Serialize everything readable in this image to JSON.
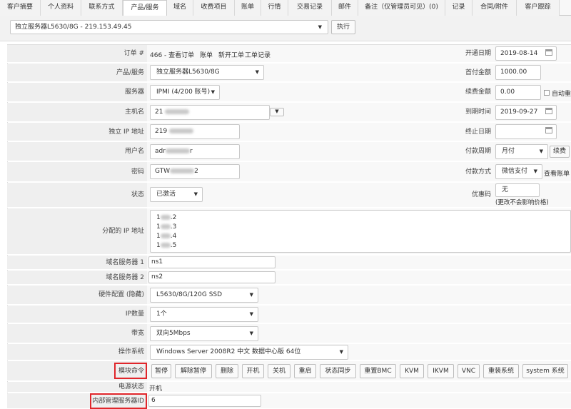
{
  "tabs": [
    "客户摘要",
    "个人资料",
    "联系方式",
    "产品/服务",
    "域名",
    "收费项目",
    "账单",
    "行情",
    "交易记录",
    "邮件",
    "备注（仅管理员可见）(0)",
    "记录",
    "合同/附件",
    "客户跟踪"
  ],
  "active_tab": "产品/服务",
  "selector": {
    "value": "独立服务器L5630/8G - 219.153.49.45",
    "execute_label": "执行"
  },
  "order": {
    "label": "订单 #",
    "number": "466 - 查看订单",
    "links": [
      "账单",
      "新开工单",
      "工单记录"
    ]
  },
  "left_fields": {
    "product_label": "产品/服务",
    "product_value": "独立服务器L5630/8G",
    "server_label": "服务器",
    "server_value": "IPMI (4/200 账号)",
    "hostname_label": "主机名",
    "hostname_prefix": "21",
    "dedicated_ip_label": "独立 IP 地址",
    "dedicated_ip_prefix": "219",
    "username_label": "用户名",
    "username_prefix": "adr",
    "username_suffix": "r",
    "password_label": "密码",
    "password_prefix": "GTW",
    "password_suffix": "2",
    "status_label": "状态",
    "status_value": "已激活",
    "assigned_ip_label": "分配的 IP 地址",
    "assigned_ips": [
      {
        "prefix": "1",
        "suffix": ".2"
      },
      {
        "prefix": "1",
        "suffix": ".3"
      },
      {
        "prefix": "1",
        "suffix": ".4"
      },
      {
        "prefix": "1",
        "suffix": ".5"
      }
    ],
    "ns1_label": "域名服务器 1",
    "ns1_value": "ns1",
    "ns2_label": "域名服务器 2",
    "ns2_value": "ns2",
    "hardware_label": "硬件配置 (隐藏)",
    "hardware_value": "L5630/8G/120G SSD",
    "ip_count_label": "IP数量",
    "ip_count_value": "1个",
    "bandwidth_label": "带宽",
    "bandwidth_value": "双向5Mbps",
    "os_label": "操作系统",
    "os_value": "Windows Server 2008R2 中文 数据中心版 64位",
    "module_label": "模块命令",
    "module_buttons": [
      "暂停",
      "解除暂停",
      "删除",
      "开机",
      "关机",
      "重启",
      "状态同步",
      "重置BMC",
      "KVM",
      "IKVM",
      "VNC",
      "重装系统",
      "system 系统"
    ],
    "power_label": "电源状态",
    "power_value": "开机",
    "internal_id_label": "内部管理服务器ID",
    "internal_id_value": "6"
  },
  "right_fields": {
    "open_date_label": "开通日期",
    "open_date_value": "2019-08-14",
    "first_amount_label": "首付金额",
    "first_amount_value": "1000.00",
    "renew_amount_label": "续费金额",
    "renew_amount_value": "0.00",
    "auto_label": "自动重",
    "due_time_label": "到期时间",
    "due_time_value": "2019-09-27",
    "end_date_label": "终止日期",
    "end_date_value": "",
    "cycle_label": "付款周期",
    "cycle_value": "月付",
    "renew_button": "续费",
    "pay_method_label": "付款方式",
    "pay_method_value": "微信支付",
    "view_bill_label": "查看账单",
    "coupon_label": "优惠码",
    "coupon_value": "无",
    "coupon_note": "(更改不会影响价格)"
  }
}
